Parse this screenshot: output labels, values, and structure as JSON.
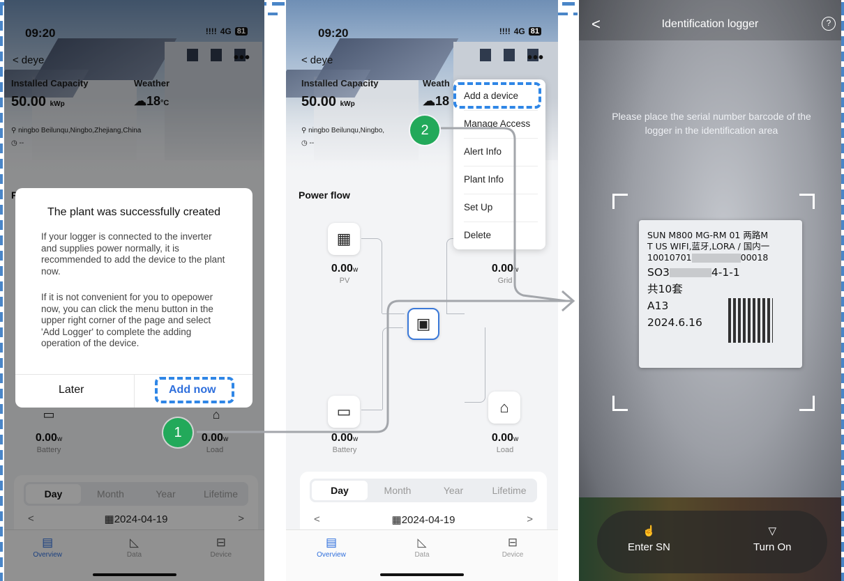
{
  "status_bar": {
    "time": "09:20",
    "signal": "!!!!",
    "network": "4G",
    "battery": "81"
  },
  "plant": {
    "name": "deye",
    "back_glyph": "<",
    "more_glyph": "•••",
    "capacity_label": "Installed Capacity",
    "capacity_value": "50.00",
    "capacity_unit": "kWp",
    "weather_label": "Weather",
    "weather_value": "18",
    "weather_unit": "°C",
    "location": "ningbo  Beilunqu,Ningbo,Zhejiang,China",
    "location_short": "ningbo  Beilunqu,Ningbo,",
    "clock_value": "--"
  },
  "power_flow": {
    "title": "Power flow",
    "pv": {
      "value": "0.00",
      "unit": "w",
      "label": "PV"
    },
    "grid": {
      "value": "0.00",
      "unit": "w",
      "label": "Grid"
    },
    "battery": {
      "value": "0.00",
      "unit": "w",
      "label": "Battery"
    },
    "load": {
      "value": "0.00",
      "unit": "w",
      "label": "Load"
    }
  },
  "period_tabs": [
    "Day",
    "Month",
    "Year",
    "Lifetime"
  ],
  "date": "2024-04-19",
  "tabbar": [
    {
      "label": "Overview",
      "icon": "overview-icon"
    },
    {
      "label": "Data",
      "icon": "chart-icon"
    },
    {
      "label": "Device",
      "icon": "device-icon"
    }
  ],
  "dialog": {
    "title": "The plant was successfully created",
    "para1": "If your logger is connected to the inverter and supplies power normally, it is recommended to add the device to the plant now.",
    "para2": "If it is not convenient for you to opepower now, you can click the menu button in the upper right corner of the page and select 'Add Logger' to complete the adding operation of the device.",
    "later": "Later",
    "add_now": "Add now"
  },
  "menu": [
    "Add a device",
    "Manage Access",
    "Alert Info",
    "Plant Info",
    "Set Up",
    "Delete"
  ],
  "steps": [
    "1",
    "2"
  ],
  "scanner": {
    "title": "Identification logger",
    "help": "?",
    "instruction": "Please place the serial number barcode of the logger in the identification area",
    "label_lines": [
      "SUN M800 MG-RM 01 两路M",
      "T US WIFI,蓝牙,LORA / 国内一",
      "10010701",
      "00018"
    ],
    "label_serial_a": "SO3",
    "label_serial_b": "4-1-1",
    "label_qty": "共10套",
    "label_code": "A13",
    "label_date": "2024.6.16",
    "enter_sn": "Enter SN",
    "turn_on": "Turn On"
  },
  "colors": {
    "accent": "#2f6fdc",
    "badge": "#22a95a",
    "highlight": "#2f86e6"
  }
}
